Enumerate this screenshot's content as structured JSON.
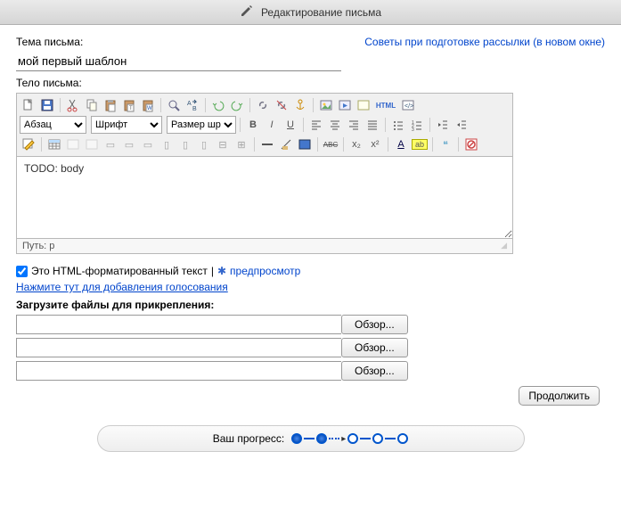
{
  "header": {
    "title": "Редактирование письма"
  },
  "labels": {
    "subject": "Тема письма:",
    "tips_link": "Советы при подготовке рассылки (в новом окне)",
    "body": "Тело письма:",
    "path": "Путь: p",
    "html_checkbox": "Это HTML-форматированный текст",
    "pipe": " | ",
    "preview": "предпросмотр",
    "add_voting": "Нажмите тут для добавления голосования",
    "upload": "Загрузите файлы для прикрепления:",
    "browse": "Обзор...",
    "continue": "Продолжить",
    "progress": "Ваш прогресс:",
    "star": "✱"
  },
  "values": {
    "subject": "мой первый шаблон",
    "body": "TODO: body",
    "html_formatted": true
  },
  "toolbar": {
    "format_select": "Абзац",
    "font_select": "Шрифт",
    "size_select": "Размер шри",
    "html_btn": "HTML"
  },
  "icons": {
    "edit": "✎",
    "newdoc": "▫",
    "bold": "B",
    "italic": "I",
    "underline": "U",
    "strike": "ABC",
    "sub": "x₂",
    "sup": "x²",
    "A": "A",
    "quote": "❝",
    "warn": "⊘"
  }
}
